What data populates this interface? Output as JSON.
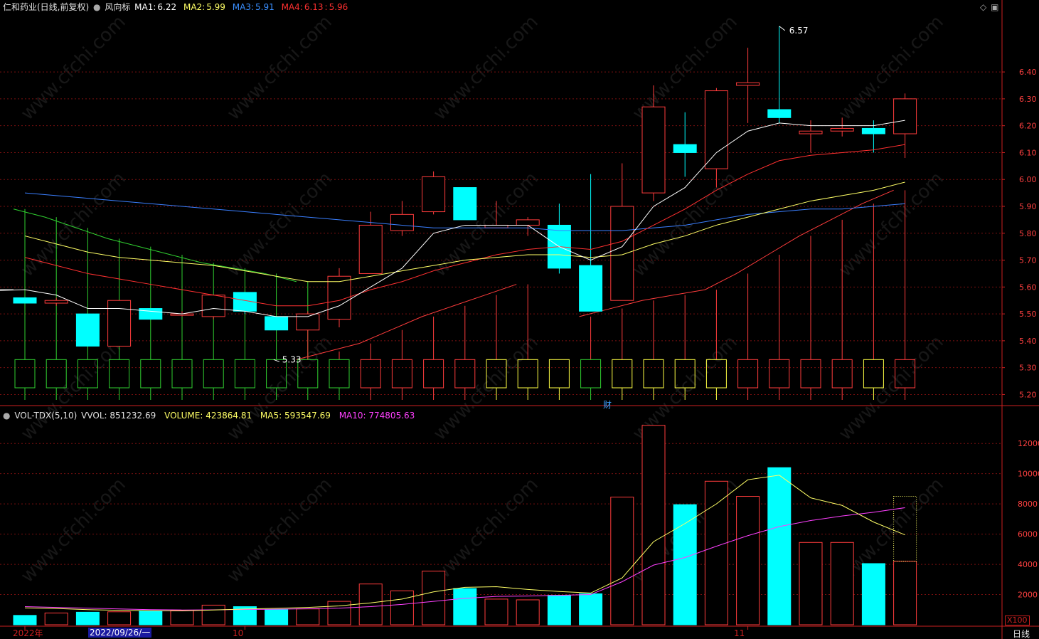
{
  "stock": {
    "title": "仁和药业(日线,前复权)",
    "indicator": "风向标",
    "ma1_label": "MA1:",
    "ma1": "6.22",
    "ma2_label": "MA2:",
    "ma2": "5.99",
    "ma3_label": "MA3:",
    "ma3": "5.91",
    "ma4_label": "MA4:",
    "ma4": "6.13",
    "ma4_extra": "5.96"
  },
  "volume_header": {
    "name": "VOL-TDX(5,10)",
    "vvol": "VVOL: 851232.69",
    "volume": "VOLUME: 423864.81",
    "ma5": "MA5: 593547.69",
    "ma10": "MA10: 774805.63"
  },
  "footer": {
    "year": "2022年",
    "cursor_date": "2022/09/26/一",
    "month_oct": "10",
    "month_nov": "11",
    "period": "日线",
    "vol_unit": "X100",
    "finance_marker": "财"
  },
  "annotations": {
    "high": "6.57",
    "low": "5.33"
  },
  "watermark": "www.cfchi.com",
  "colors": {
    "up": "#ff3c3c",
    "down": "#00ffff",
    "ma1": "#ffffff",
    "ma2": "#ffff66",
    "ma3": "#3a7fff",
    "ma4": "#ff3030",
    "vma10": "#ff40ff",
    "grid": "#7a1010",
    "axis": "#cc2020",
    "tick": "#ff4040"
  },
  "chart_data": {
    "type": "candlestick",
    "price_axis": {
      "ticks": [
        5.2,
        5.3,
        5.4,
        5.5,
        5.6,
        5.7,
        5.8,
        5.9,
        6.0,
        6.1,
        6.2,
        6.3,
        6.4
      ],
      "ylim": [
        5.18,
        6.62
      ]
    },
    "volume_axis": {
      "ticks": [
        2000,
        4000,
        6000,
        8000,
        10000,
        12000
      ],
      "ylim": [
        0,
        13800
      ],
      "unit": "X100"
    },
    "candles": [
      {
        "o": 5.56,
        "h": 5.56,
        "l": 5.54,
        "c": 5.54,
        "v": 620
      },
      {
        "o": 5.54,
        "h": 5.56,
        "l": 5.53,
        "c": 5.55,
        "v": 780
      },
      {
        "o": 5.5,
        "h": 5.5,
        "l": 5.38,
        "c": 5.38,
        "v": 830
      },
      {
        "o": 5.38,
        "h": 5.55,
        "l": 5.38,
        "c": 5.55,
        "v": 860
      },
      {
        "o": 5.52,
        "h": 5.52,
        "l": 5.48,
        "c": 5.48,
        "v": 900
      },
      {
        "o": 5.5,
        "h": 5.51,
        "l": 5.49,
        "c": 5.5,
        "v": 950
      },
      {
        "o": 5.49,
        "h": 5.57,
        "l": 5.48,
        "c": 5.57,
        "v": 1300
      },
      {
        "o": 5.58,
        "h": 5.58,
        "l": 5.5,
        "c": 5.51,
        "v": 1200
      },
      {
        "o": 5.49,
        "h": 5.49,
        "l": 5.44,
        "c": 5.44,
        "v": 1000
      },
      {
        "o": 5.44,
        "h": 5.51,
        "l": 5.33,
        "c": 5.5,
        "v": 1050
      },
      {
        "o": 5.48,
        "h": 5.67,
        "l": 5.45,
        "c": 5.64,
        "v": 1550
      },
      {
        "o": 5.65,
        "h": 5.88,
        "l": 5.65,
        "c": 5.83,
        "v": 2700
      },
      {
        "o": 5.81,
        "h": 5.92,
        "l": 5.79,
        "c": 5.87,
        "v": 2250
      },
      {
        "o": 5.88,
        "h": 6.03,
        "l": 5.87,
        "c": 6.01,
        "v": 3550
      },
      {
        "o": 5.97,
        "h": 5.97,
        "l": 5.85,
        "c": 5.85,
        "v": 2400
      },
      {
        "o": 5.82,
        "h": 5.92,
        "l": 5.82,
        "c": 5.83,
        "v": 1700
      },
      {
        "o": 5.83,
        "h": 5.86,
        "l": 5.79,
        "c": 5.85,
        "v": 1650
      },
      {
        "o": 5.83,
        "h": 5.91,
        "l": 5.65,
        "c": 5.67,
        "v": 1950
      },
      {
        "o": 5.68,
        "h": 6.02,
        "l": 5.51,
        "c": 5.51,
        "v": 2050
      },
      {
        "o": 5.55,
        "h": 6.06,
        "l": 5.55,
        "c": 5.9,
        "v": 8450
      },
      {
        "o": 5.95,
        "h": 6.35,
        "l": 5.92,
        "c": 6.27,
        "v": 13200
      },
      {
        "o": 6.13,
        "h": 6.25,
        "l": 6.01,
        "c": 6.1,
        "v": 7950
      },
      {
        "o": 6.04,
        "h": 6.34,
        "l": 5.97,
        "c": 6.33,
        "v": 9500
      },
      {
        "o": 6.35,
        "h": 6.49,
        "l": 6.21,
        "c": 6.36,
        "v": 8500
      },
      {
        "o": 6.26,
        "h": 6.57,
        "l": 6.21,
        "c": 6.23,
        "v": 10400
      },
      {
        "o": 6.17,
        "h": 6.22,
        "l": 6.1,
        "c": 6.18,
        "v": 5450
      },
      {
        "o": 6.18,
        "h": 6.23,
        "l": 6.16,
        "c": 6.19,
        "v": 5450
      },
      {
        "o": 6.19,
        "h": 6.22,
        "l": 6.1,
        "c": 6.17,
        "v": 4050
      },
      {
        "o": 6.17,
        "h": 6.32,
        "l": 6.08,
        "c": 6.3,
        "v": 4200
      }
    ],
    "ma1": [
      5.59,
      5.57,
      5.52,
      5.52,
      5.51,
      5.5,
      5.52,
      5.51,
      5.49,
      5.49,
      5.53,
      5.6,
      5.67,
      5.8,
      5.83,
      5.83,
      5.83,
      5.75,
      5.7,
      5.75,
      5.9,
      5.97,
      6.1,
      6.18,
      6.21,
      6.2,
      6.2,
      6.2,
      6.22
    ],
    "ma2": [
      5.79,
      5.76,
      5.73,
      5.71,
      5.7,
      5.69,
      5.68,
      5.66,
      5.64,
      5.62,
      5.62,
      5.64,
      5.66,
      5.68,
      5.7,
      5.71,
      5.72,
      5.72,
      5.71,
      5.72,
      5.76,
      5.79,
      5.83,
      5.86,
      5.89,
      5.92,
      5.94,
      5.96,
      5.99
    ],
    "ma3": [
      5.95,
      5.94,
      5.93,
      5.92,
      5.91,
      5.9,
      5.89,
      5.88,
      5.87,
      5.86,
      5.85,
      5.84,
      5.83,
      5.82,
      5.82,
      5.82,
      5.82,
      5.81,
      5.81,
      5.81,
      5.82,
      5.83,
      5.85,
      5.87,
      5.88,
      5.89,
      5.89,
      5.9,
      5.91
    ],
    "ma4": [
      5.71,
      5.68,
      5.65,
      5.63,
      5.61,
      5.59,
      5.57,
      5.55,
      5.53,
      5.53,
      5.55,
      5.59,
      5.62,
      5.66,
      5.69,
      5.72,
      5.74,
      5.75,
      5.74,
      5.77,
      5.83,
      5.89,
      5.96,
      6.02,
      6.07,
      6.09,
      6.1,
      6.11,
      6.13
    ],
    "band_upper_green": [
      5.89,
      5.86,
      5.82,
      5.78,
      5.75,
      5.72,
      5.69,
      5.67,
      5.65,
      5.62
    ],
    "band_lower_red": [
      5.33,
      5.36,
      5.39,
      5.44,
      5.49,
      5.53,
      5.57,
      5.61,
      null,
      5.49,
      5.52,
      5.55,
      5.57,
      5.59,
      5.65,
      5.72,
      5.79,
      5.85,
      5.91,
      5.96
    ],
    "vol_ma5": [
      1120,
      1080,
      1000,
      960,
      930,
      920,
      980,
      1040,
      1090,
      1150,
      1250,
      1450,
      1700,
      2180,
      2480,
      2520,
      2340,
      2200,
      2100,
      3100,
      5500,
      6700,
      8000,
      9600,
      9900,
      8400,
      7900,
      6800,
      5950
    ],
    "vol_ma10": [
      1200,
      1150,
      1100,
      1050,
      1000,
      980,
      990,
      1010,
      1030,
      1060,
      1100,
      1200,
      1350,
      1550,
      1750,
      1880,
      1900,
      1950,
      2000,
      2850,
      3950,
      4450,
      5200,
      5900,
      6500,
      6900,
      7200,
      7450,
      7750
    ],
    "x_labels": [
      "2022年",
      "10",
      "11"
    ]
  }
}
